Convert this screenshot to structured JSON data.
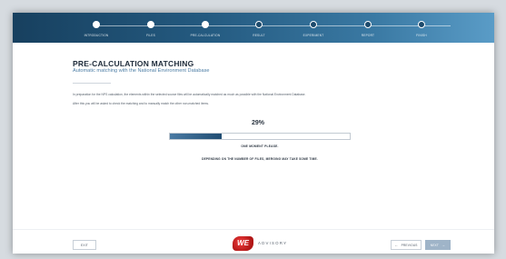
{
  "steps": [
    {
      "label": "INTRODUCTION",
      "state": "done"
    },
    {
      "label": "FILES",
      "state": "done"
    },
    {
      "label": "PRE-CALCULATION",
      "state": "current"
    },
    {
      "label": "RESULT",
      "state": "todo"
    },
    {
      "label": "EXPERIMENT",
      "state": "todo"
    },
    {
      "label": "REPORT",
      "state": "todo"
    },
    {
      "label": "FINISH",
      "state": "todo"
    }
  ],
  "page": {
    "title": "PRE-CALCULATION MATCHING",
    "subtitle": "Automatic matching with the National Environment Database",
    "paragraph_1": "In preparation for the NPS calculation, the elements within the selected source files will be automatically matched as much as possible with the National Environment Database.",
    "paragraph_2": "After this you will be asked to check the matching and to manually match the other non-matched items."
  },
  "progress": {
    "percent_label": "29%",
    "fraction": 0.29,
    "wait_text": "ONE MOMENT PLEASE.",
    "note_text": "DEPENDING ON THE NUMBER OF FILES, MERGING MAY TAKE SOME TIME."
  },
  "footer": {
    "exit_label": "EXIT",
    "previous_label": "PREVIOUS",
    "next_label": "NEXT",
    "logo_text": "WE",
    "brand_text": "ADVISORY"
  },
  "colors": {
    "header_dark": "#17405f",
    "header_light": "#5a9cc7",
    "accent": "#4f7fa6",
    "progress_fill": "#204d72",
    "logo_red": "#d42a2a"
  }
}
